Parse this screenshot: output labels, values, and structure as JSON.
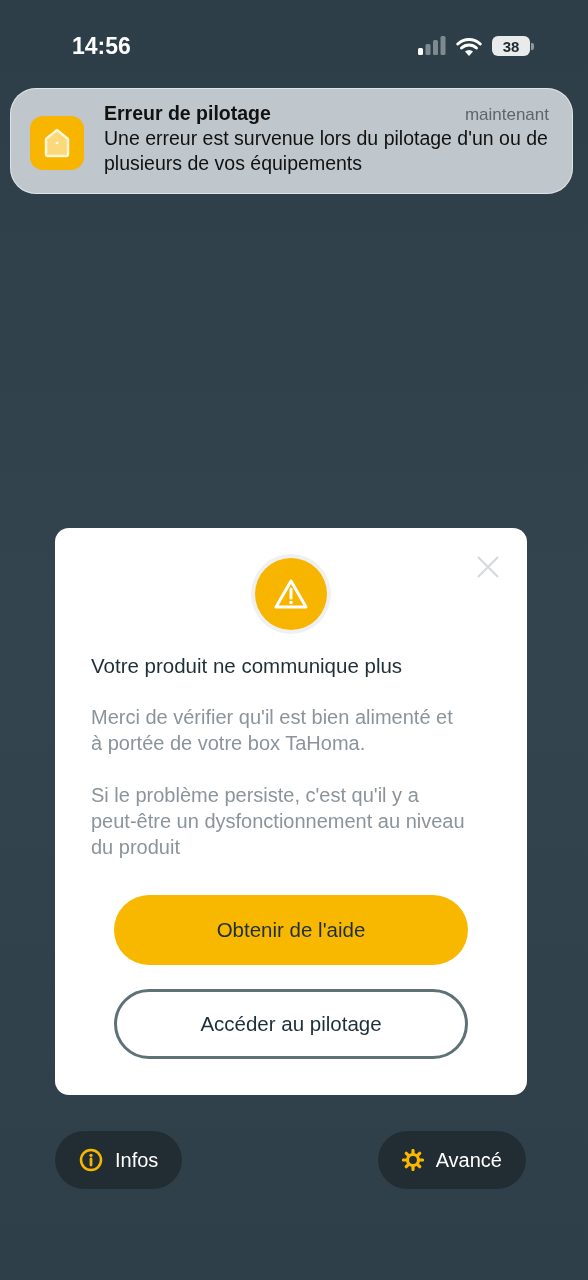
{
  "status_bar": {
    "time": "14:56",
    "battery": "38"
  },
  "notification": {
    "title": "Erreur de pilotage",
    "time": "maintenant",
    "message": "Une erreur est survenue lors du pilotage d'un ou de plusieurs de vos équipements"
  },
  "dialog": {
    "title": "Votre produit ne communique plus",
    "paragraphs": [
      "Merci de vérifier qu'il est bien alimenté et à portée de votre box TaHoma.",
      "Si le problème persiste, c'est qu'il y a peut-être un dysfonctionnement au niveau du produit"
    ],
    "buttons": [
      {
        "label": "Obtenir de l'aide",
        "kind": "primary"
      },
      {
        "label": "Accéder au pilotage",
        "kind": "outline"
      }
    ]
  },
  "bottom_buttons": [
    {
      "label": "Infos",
      "kind": "info"
    },
    {
      "label": "Avancé",
      "kind": "settings"
    }
  ]
}
